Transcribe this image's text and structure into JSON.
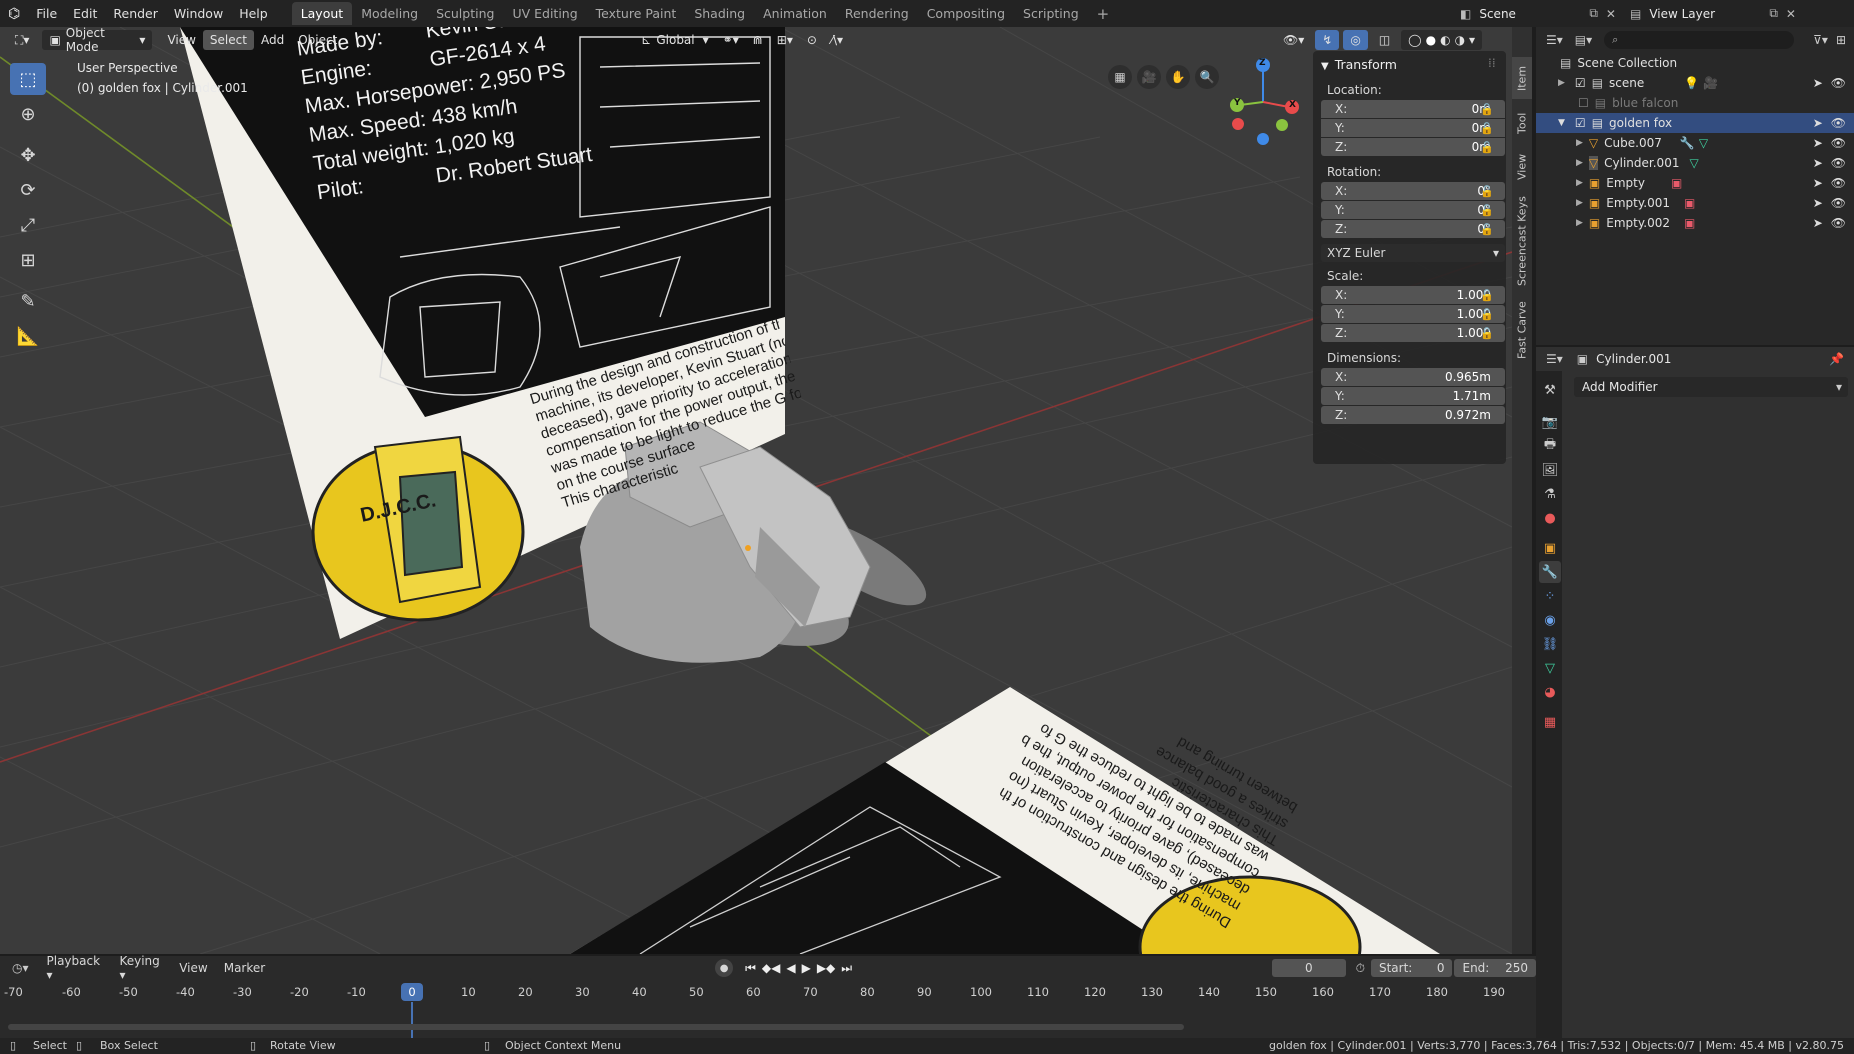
{
  "topbar": {
    "menus": [
      "File",
      "Edit",
      "Render",
      "Window",
      "Help"
    ],
    "workspaces": [
      "Layout",
      "Modeling",
      "Sculpting",
      "UV Editing",
      "Texture Paint",
      "Shading",
      "Animation",
      "Rendering",
      "Compositing",
      "Scripting"
    ],
    "active_workspace": "Layout",
    "add_tab": "+",
    "scene": "Scene",
    "view_layer": "View Layer"
  },
  "viewport": {
    "mode": "Object Mode",
    "menus": [
      "View",
      "Select",
      "Add",
      "Object"
    ],
    "transform_orientation": "Global",
    "perspective_label": "User Perspective",
    "object_label": "(0) golden fox | Cylinder.001",
    "blueprint": {
      "lines": [
        "Made by:",
        "Engine:",
        "Max. Horsepower:",
        "Max. Speed:",
        "Total weight:",
        "Pilot:"
      ],
      "values": [
        "Kevin Stuart",
        "GF-2614 x 4",
        "2,950 PS",
        "438 km/h",
        "1,020 kg",
        "Dr. Robert Stuart"
      ],
      "paragraph": [
        "During the design and construction of th",
        "machine, its developer, Kevin Stuart (no",
        "deceased), gave priority to acceleration",
        "compensation for the power output, the b",
        "was made to be light to reduce the G fo",
        "on the course surface",
        "This characteristic",
        "strikes a good balance",
        "between turning and"
      ],
      "emblem_text": "D.J.C.C."
    },
    "gizmo": {
      "x": "X",
      "y": "Y",
      "z": "Z"
    }
  },
  "npanel": {
    "title": "Transform",
    "location_label": "Location:",
    "location": [
      {
        "axis": "X:",
        "value": "0m"
      },
      {
        "axis": "Y:",
        "value": "0m"
      },
      {
        "axis": "Z:",
        "value": "0m"
      }
    ],
    "rotation_label": "Rotation:",
    "rotation": [
      {
        "axis": "X:",
        "value": "0°"
      },
      {
        "axis": "Y:",
        "value": "0°"
      },
      {
        "axis": "Z:",
        "value": "0°"
      }
    ],
    "rotation_mode": "XYZ Euler",
    "scale_label": "Scale:",
    "scale": [
      {
        "axis": "X:",
        "value": "1.000"
      },
      {
        "axis": "Y:",
        "value": "1.000"
      },
      {
        "axis": "Z:",
        "value": "1.000"
      }
    ],
    "dimensions_label": "Dimensions:",
    "dimensions": [
      {
        "axis": "X:",
        "value": "0.965m"
      },
      {
        "axis": "Y:",
        "value": "1.71m"
      },
      {
        "axis": "Z:",
        "value": "0.972m"
      }
    ]
  },
  "sidetabs": [
    "Item",
    "Tool",
    "View",
    "Screencast Keys",
    "Fast Carve"
  ],
  "outliner": {
    "root": "Scene Collection",
    "rows": [
      {
        "name": "scene",
        "type": "collection",
        "depth": 1,
        "checked": true
      },
      {
        "name": "blue falcon",
        "type": "collection",
        "depth": 1,
        "checked": false,
        "dim": true
      },
      {
        "name": "golden fox",
        "type": "collection",
        "depth": 1,
        "checked": true,
        "selected": true
      },
      {
        "name": "Cube.007",
        "type": "mesh",
        "depth": 2
      },
      {
        "name": "Cylinder.001",
        "type": "mesh",
        "depth": 2
      },
      {
        "name": "Empty",
        "type": "empty",
        "depth": 2
      },
      {
        "name": "Empty.001",
        "type": "empty",
        "depth": 2
      },
      {
        "name": "Empty.002",
        "type": "empty",
        "depth": 2
      }
    ]
  },
  "properties": {
    "object_name": "Cylinder.001",
    "add_modifier": "Add Modifier"
  },
  "timeline": {
    "menus": [
      "Playback",
      "Keying",
      "View",
      "Marker"
    ],
    "current_frame": "0",
    "start_label": "Start:",
    "start": "0",
    "end_label": "End:",
    "end": "250",
    "ruler": [
      "-70",
      "-60",
      "-50",
      "-40",
      "-30",
      "-20",
      "-10",
      "0",
      "10",
      "20",
      "30",
      "40",
      "50",
      "60",
      "70",
      "80",
      "90",
      "100",
      "110",
      "120",
      "130",
      "140",
      "150",
      "160",
      "170",
      "180",
      "190"
    ],
    "playhead": "0"
  },
  "statusbar": {
    "select": "Select",
    "box_select": "Box Select",
    "rotate_view": "Rotate View",
    "context_menu": "Object Context Menu",
    "stats": "golden fox | Cylinder.001 | Verts:3,770 | Faces:3,764 | Tris:7,532 | Objects:0/7 | Mem: 45.4 MB | v2.80.75"
  },
  "colors": {
    "accent": "#4772b3",
    "selected_row": "#334d80",
    "axis_x": "#e84b4b",
    "axis_y": "#8ac33f",
    "axis_z": "#3f8ae8"
  }
}
